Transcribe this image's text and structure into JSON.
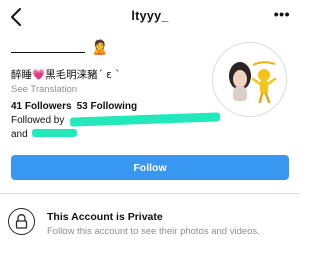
{
  "header": {
    "username": "ltyyy_",
    "more_label": "•••"
  },
  "profile": {
    "name_emoji": "🙎",
    "bio_prefix": "醉睡",
    "bio_heart": "💗",
    "bio_rest": "黑毛明涞豬ˊ ε ˋ",
    "see_translation": "See Translation",
    "followers": "41 Followers",
    "following": "53 Following",
    "followed_by_label": "Followed by",
    "and_label": "and"
  },
  "actions": {
    "follow_label": "Follow"
  },
  "private_notice": {
    "title": "This Account is Private",
    "subtitle": "Follow this account to see their photos and videos."
  },
  "colors": {
    "accent": "#3897f0",
    "redaction": "#22e8bb",
    "muted": "#8e8e8e"
  },
  "icons": [
    "back-arrow-icon",
    "more-options-icon",
    "lock-icon"
  ]
}
